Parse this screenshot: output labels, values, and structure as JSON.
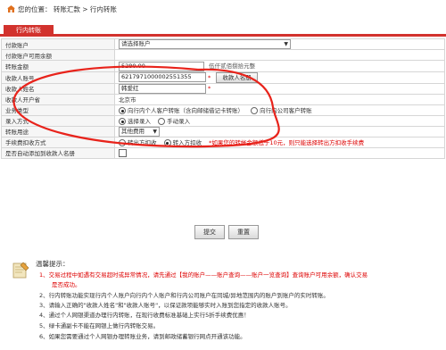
{
  "breadcrumb": {
    "text": "您的位置：  转账汇款  >  行内转账"
  },
  "tab": {
    "label": "行内转账"
  },
  "form": {
    "pay_account": {
      "label": "付款账户",
      "value": "请选择账户"
    },
    "pay_balance": {
      "label": "付款账户可用余额"
    },
    "amount": {
      "label": "转账金额",
      "value": "5280.00",
      "hint": "伍仟贰佰捌拾元整"
    },
    "payee_account": {
      "label": "收款人账号",
      "value": "6217971000002551355",
      "star": "*",
      "button": "收款人名册"
    },
    "payee_name": {
      "label": "收款人姓名",
      "value": "韩爱红",
      "star": "*"
    },
    "payee_bank": {
      "label": "收款人开户省",
      "value": "北京市"
    },
    "biz_type": {
      "label": "业务类型",
      "options": [
        "向行内个人客户转账（含向邮储借记卡转账）",
        "向行内公司客户转账"
      ]
    },
    "entry_mode": {
      "label": "录入方式",
      "options": [
        "选择录入",
        "手动录入"
      ]
    },
    "purpose": {
      "label": "转账用途",
      "value": "其他费用"
    },
    "fee_mode": {
      "label": "手续费扣收方式",
      "options": [
        "转出方扣收",
        "转入方扣收"
      ],
      "note": "*如果您的转帐金额低于10元，则只能选择转出方扣收手续费"
    },
    "add_payee": {
      "label": "是否自动添加到收款人名册"
    }
  },
  "buttons": {
    "submit": "提交",
    "reset": "重置"
  },
  "tips": {
    "title": "温馨提示：",
    "items": [
      "1、交易过程中如遇有交易超时或异常情况，请先通过【我的账户——账户查询——账户一览查询】查询账户可用余额，确认交易",
      "是否成功。",
      "2、行内转账功能实现行内个人账户向行内个人账户和行内公司账户在同城/异地范围内的账户到账户的实时转账。",
      "3、请输入正确的\"收款人姓名\"和\"收款人账号\"，以保证款项能够实时入账到您指定的收款人账号。",
      "4、通过个人网银渠道办理行内转账，在现行收费标准基础上实行5折手续费优惠！",
      "5、绿卡通副卡不能在网银上做行内转账交易。",
      "6、如果您需要通过个人网银办理转账业务，请到邮政储蓄银行网点开通该功能。"
    ]
  }
}
